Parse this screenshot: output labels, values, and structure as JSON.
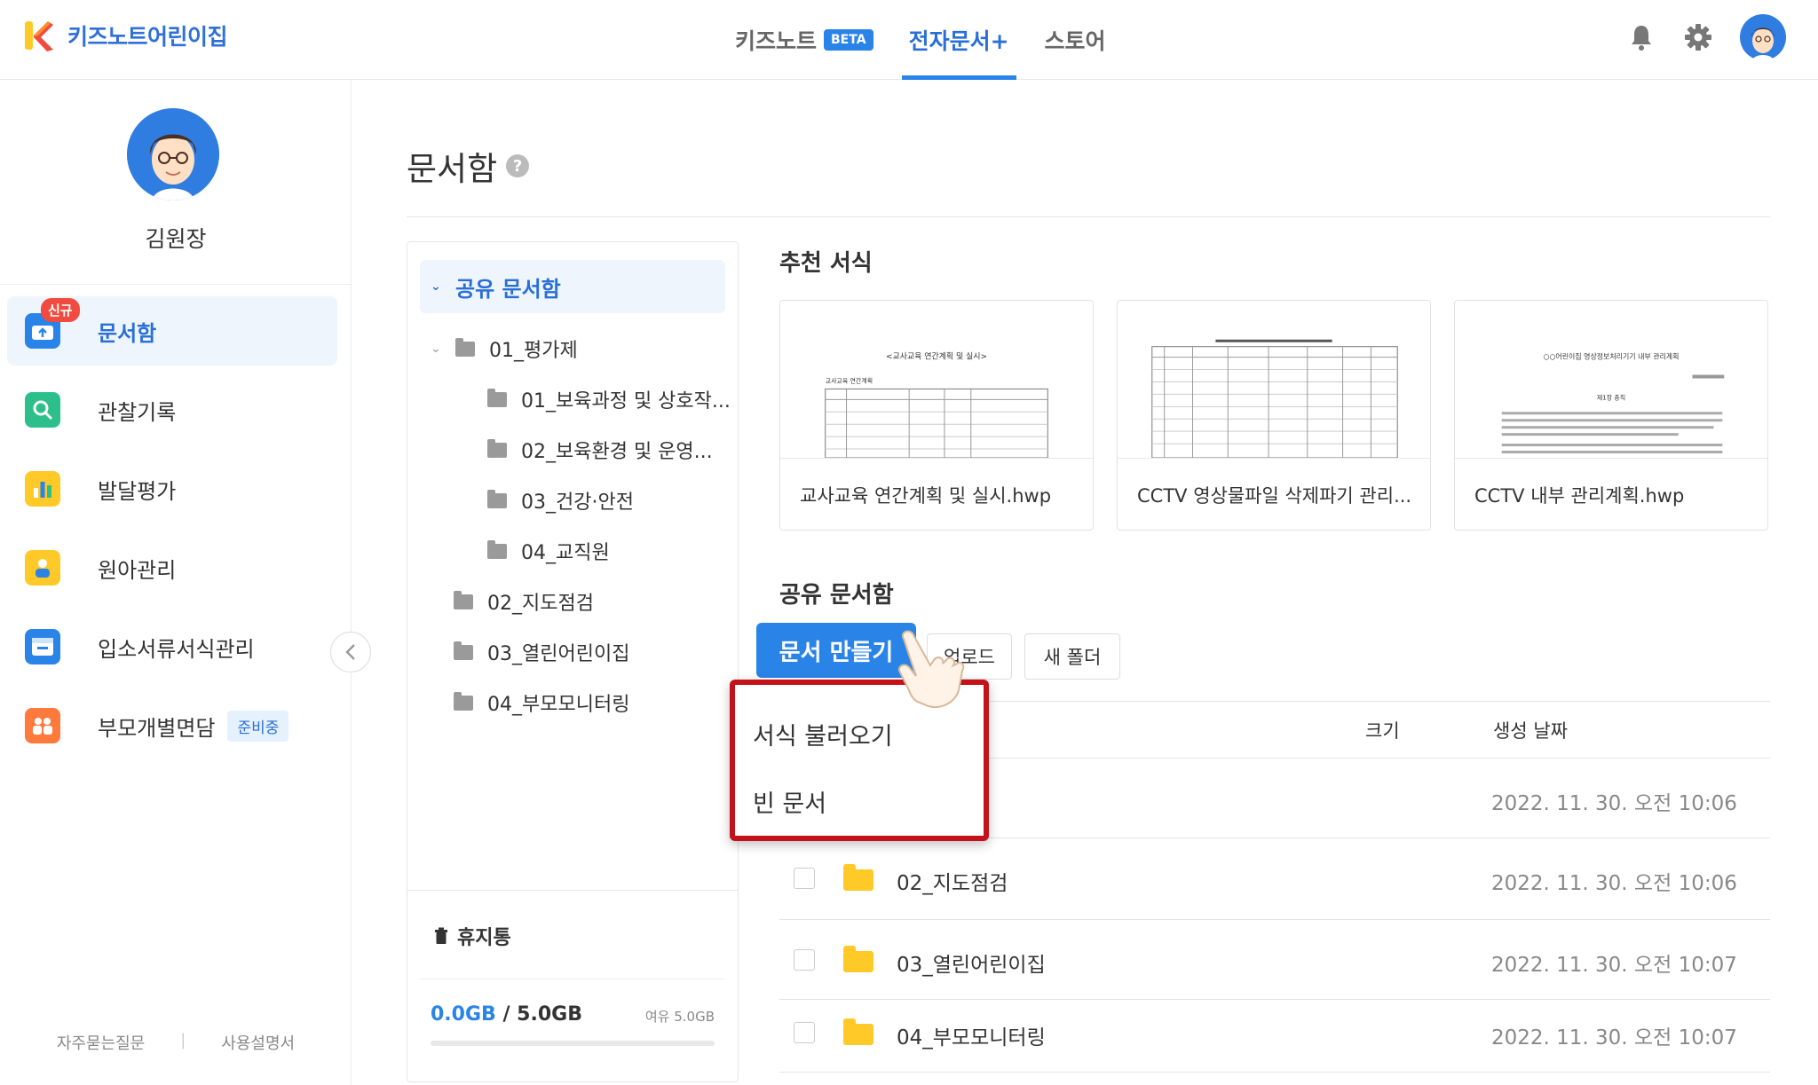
{
  "header": {
    "logo_text": "키즈노트어린이집",
    "nav": [
      {
        "label": "키즈노트",
        "badge": "BETA",
        "active": false
      },
      {
        "label": "전자문서+",
        "badge": "",
        "active": true
      },
      {
        "label": "스토어",
        "badge": "",
        "active": false
      }
    ],
    "accent": "#2a84e8"
  },
  "sidebar": {
    "profile_name": "김원장",
    "menu": [
      {
        "label": "문서함",
        "badge": "신규",
        "active": true,
        "icon": "document-box-icon"
      },
      {
        "label": "관찰기록",
        "icon": "search-icon"
      },
      {
        "label": "발달평가",
        "icon": "bar-chart-icon"
      },
      {
        "label": "원아관리",
        "icon": "children-icon"
      },
      {
        "label": "입소서류서식관리",
        "icon": "form-icon"
      },
      {
        "label": "부모개별면담",
        "tag": "준비중",
        "icon": "family-icon"
      }
    ],
    "footer": {
      "faq": "자주묻는질문",
      "manual": "사용설명서"
    }
  },
  "main": {
    "title": "문서함",
    "tree": {
      "root": "공유 문서함",
      "items": [
        {
          "label": "01_평가제",
          "level": 0,
          "expanded": true
        },
        {
          "label": "01_보육과정 및 상호작...",
          "level": 1
        },
        {
          "label": "02_보육환경 및 운영...",
          "level": 1
        },
        {
          "label": "03_건강·안전",
          "level": 1
        },
        {
          "label": "04_교직원",
          "level": 1
        },
        {
          "label": "02_지도점검",
          "level": 0
        },
        {
          "label": "03_열린어린이집",
          "level": 0
        },
        {
          "label": "04_부모모니터링",
          "level": 0
        }
      ],
      "trash": "휴지통",
      "storage_used": "0.0GB",
      "storage_total": "/ 5.0GB",
      "storage_free": "여유 5.0GB",
      "storage_fraction": 0.0
    },
    "recommended": {
      "title": "추천 서식",
      "cards": [
        {
          "label": "교사교육 연간계획 및 실시.hwp",
          "thumb_title": "<교사교육 연간계획 및 실시>",
          "thumb_sub": "교사교육 연간계획"
        },
        {
          "label": "CCTV 영상물파일 삭제파기 관리...",
          "thumb_title": "",
          "thumb_sub": ""
        },
        {
          "label": "CCTV 내부 관리계획.hwp",
          "thumb_title": "○○어린이집 영상정보처리기기 내부 관리계획",
          "thumb_sub": "제1장 총칙"
        }
      ]
    },
    "shared": {
      "title": "공유 문서함",
      "create_button": "문서 만들기",
      "upload_button": "업로드",
      "new_folder_button": "새 폴더",
      "columns": {
        "size": "크기",
        "date": "생성 날짜"
      },
      "rows": [
        {
          "name": "",
          "date": "2022. 11. 30. 오전 10:06"
        },
        {
          "name": "02_지도점검",
          "date": "2022. 11. 30. 오전 10:06"
        },
        {
          "name": "03_열린어린이집",
          "date": "2022. 11. 30. 오전 10:07"
        },
        {
          "name": "04_부모모니터링",
          "date": "2022. 11. 30. 오전 10:07"
        }
      ]
    },
    "dropdown": {
      "items": [
        "서식 불러오기",
        "빈 문서"
      ]
    }
  }
}
